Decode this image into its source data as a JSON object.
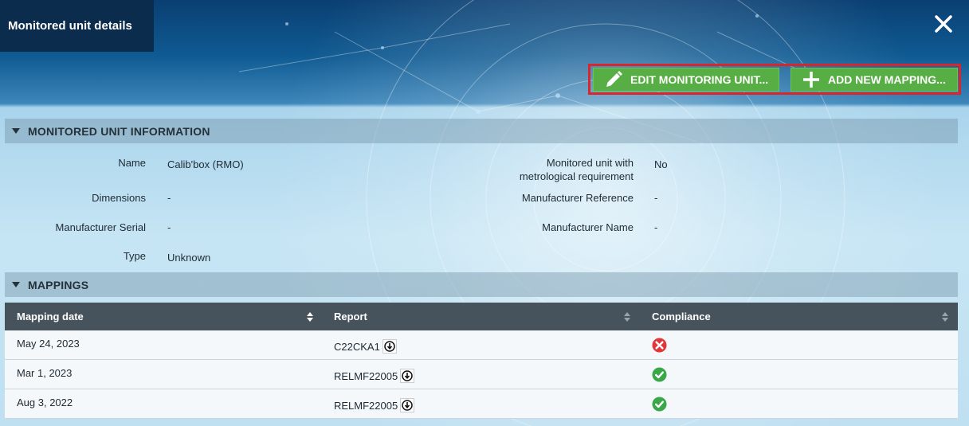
{
  "window": {
    "title": "Monitored unit details"
  },
  "actions": {
    "edit_label": "EDIT MONITORING UNIT...",
    "add_label": "ADD NEW MAPPING..."
  },
  "info_section": {
    "title": "MONITORED UNIT INFORMATION",
    "left": [
      {
        "label": "Name",
        "value": "Calib'box (RMO)"
      },
      {
        "label": "Dimensions",
        "value": "-"
      },
      {
        "label": "Manufacturer Serial",
        "value": "-"
      },
      {
        "label": "Type",
        "value": "Unknown"
      }
    ],
    "right": [
      {
        "label_line1": "Monitored unit with",
        "label_line2": "metrological requirement",
        "value": "No"
      },
      {
        "label": "Manufacturer Reference",
        "value": "-"
      },
      {
        "label": "Manufacturer Name",
        "value": "-"
      }
    ]
  },
  "mappings_section": {
    "title": "MAPPINGS",
    "columns": [
      "Mapping date",
      "Report",
      "Compliance"
    ],
    "rows": [
      {
        "date": "May 24, 2023",
        "report": "C22CKA1",
        "compliance": "fail"
      },
      {
        "date": "Mar 1, 2023",
        "report": "RELMF22005",
        "compliance": "pass"
      },
      {
        "date": "Aug 3, 2022",
        "report": "RELMF22005",
        "compliance": "pass"
      }
    ]
  },
  "colors": {
    "button_green": "#56ae44",
    "highlight_red": "#d9262c",
    "pass_green": "#3aa849",
    "fail_red": "#e2363b",
    "table_header": "#47535c"
  },
  "icons": {
    "close": "close-icon",
    "edit": "pencil-icon",
    "add": "plus-icon",
    "collapse": "caret-down-icon",
    "sort": "sort-icon",
    "download": "download-icon",
    "pass": "check-circle-icon",
    "fail": "x-circle-icon"
  }
}
